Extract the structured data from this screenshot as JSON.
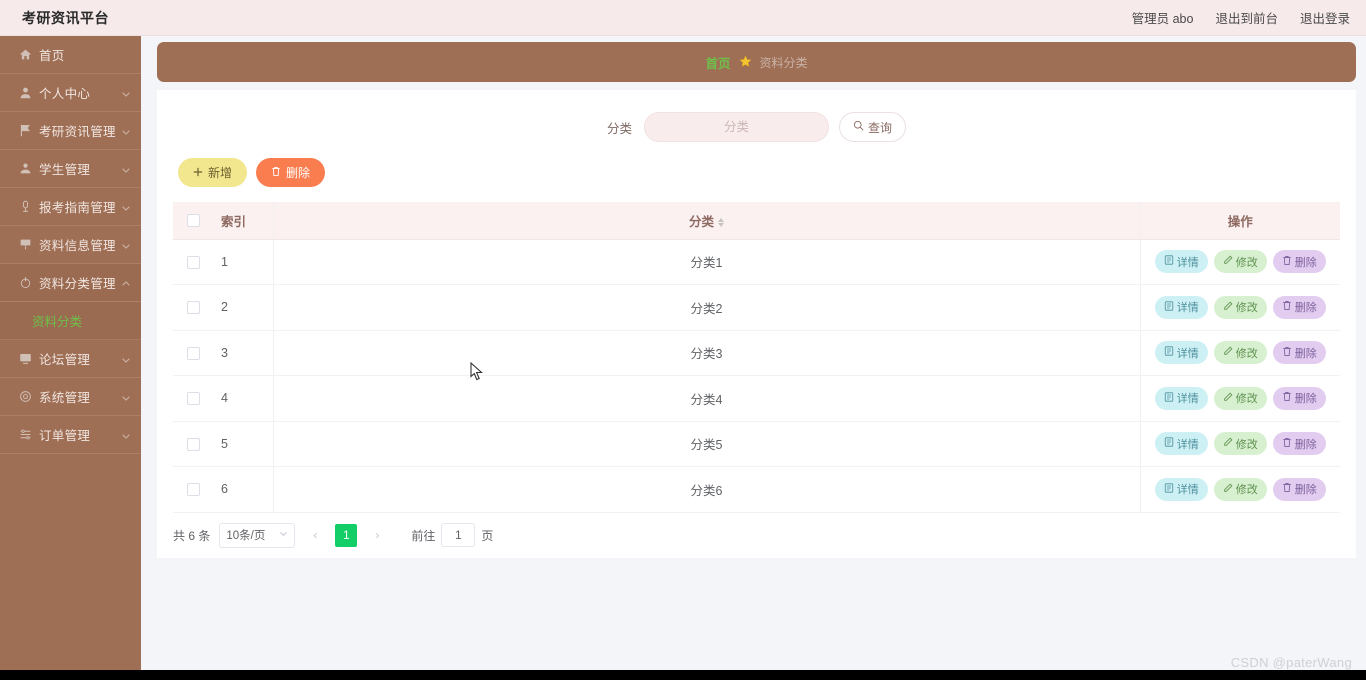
{
  "header": {
    "title": "考研资讯平台",
    "user": "管理员 abo",
    "exit_front": "退出到前台",
    "logout": "退出登录"
  },
  "sidebar": {
    "items": [
      {
        "label": "首页",
        "icon": "home-icon",
        "arrow": false,
        "active": false
      },
      {
        "label": "个人中心",
        "icon": "user-icon",
        "arrow": true,
        "active": false
      },
      {
        "label": "考研资讯管理",
        "icon": "flag-icon",
        "arrow": true,
        "active": false
      },
      {
        "label": "学生管理",
        "icon": "student-icon",
        "arrow": true,
        "active": false
      },
      {
        "label": "报考指南管理",
        "icon": "guide-icon",
        "arrow": true,
        "active": false
      },
      {
        "label": "资料信息管理",
        "icon": "doc-icon",
        "arrow": true,
        "active": false
      },
      {
        "label": "资料分类管理",
        "icon": "power-icon",
        "arrow": true,
        "active": true
      },
      {
        "label": "论坛管理",
        "icon": "monitor-icon",
        "arrow": true,
        "active": false
      },
      {
        "label": "系统管理",
        "icon": "settings-icon",
        "arrow": true,
        "active": false
      },
      {
        "label": "订单管理",
        "icon": "order-icon",
        "arrow": true,
        "active": false
      }
    ],
    "submenu": {
      "parent": "资料分类管理",
      "label": "资料分类"
    }
  },
  "breadcrumb": {
    "home": "首页",
    "star": "★",
    "current": "资料分类"
  },
  "search": {
    "label": "分类",
    "value": "",
    "placeholder": "分类",
    "button": "查询",
    "button_icon": "search-icon"
  },
  "toolbar": {
    "add_label": "新增",
    "add_icon": "plus-icon",
    "delete_label": "删除",
    "delete_icon": "trash-icon"
  },
  "table": {
    "columns": {
      "index": "索引",
      "category": "分类",
      "operations": "操作"
    },
    "row_actions": {
      "detail": "详情",
      "detail_icon": "document-icon",
      "edit": "修改",
      "edit_icon": "pencil-icon",
      "delete": "删除",
      "delete_icon": "trash-icon"
    },
    "rows": [
      {
        "index": "1",
        "category": "分类1",
        "hover": false
      },
      {
        "index": "2",
        "category": "分类2",
        "hover": false
      },
      {
        "index": "3",
        "category": "分类3",
        "hover": true
      },
      {
        "index": "4",
        "category": "分类4",
        "hover": false
      },
      {
        "index": "5",
        "category": "分类5",
        "hover": false
      },
      {
        "index": "6",
        "category": "分类6",
        "hover": false
      }
    ]
  },
  "pagination": {
    "total": "共 6 条",
    "page_size": "10条/页",
    "prev": "‹",
    "next": "›",
    "current_page": "1",
    "jump_prefix": "前往",
    "jump_value": "1",
    "jump_suffix": "页"
  },
  "watermark": "CSDN @paterWang",
  "colors": {
    "sidebar": "#9e6e55",
    "header": "#f7eaeb",
    "accent_green": "#6ec04a",
    "page_active": "#13ce66",
    "btn_add": "#f2e68e",
    "btn_delete": "#f97d4f"
  }
}
